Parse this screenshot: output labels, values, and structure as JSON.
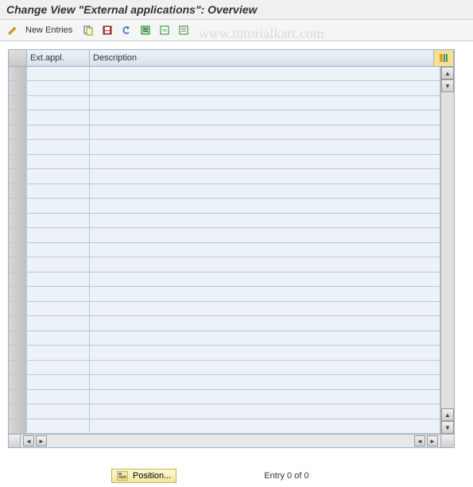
{
  "header": {
    "title": "Change View \"External applications\": Overview"
  },
  "toolbar": {
    "new_entries_label": "New Entries"
  },
  "watermark": "www.tutorialkart.com",
  "grid": {
    "columns": {
      "ext_appl": "Ext.appl.",
      "description": "Description"
    },
    "rows": []
  },
  "footer": {
    "position_label": "Position...",
    "entry_text": "Entry 0 of 0"
  }
}
